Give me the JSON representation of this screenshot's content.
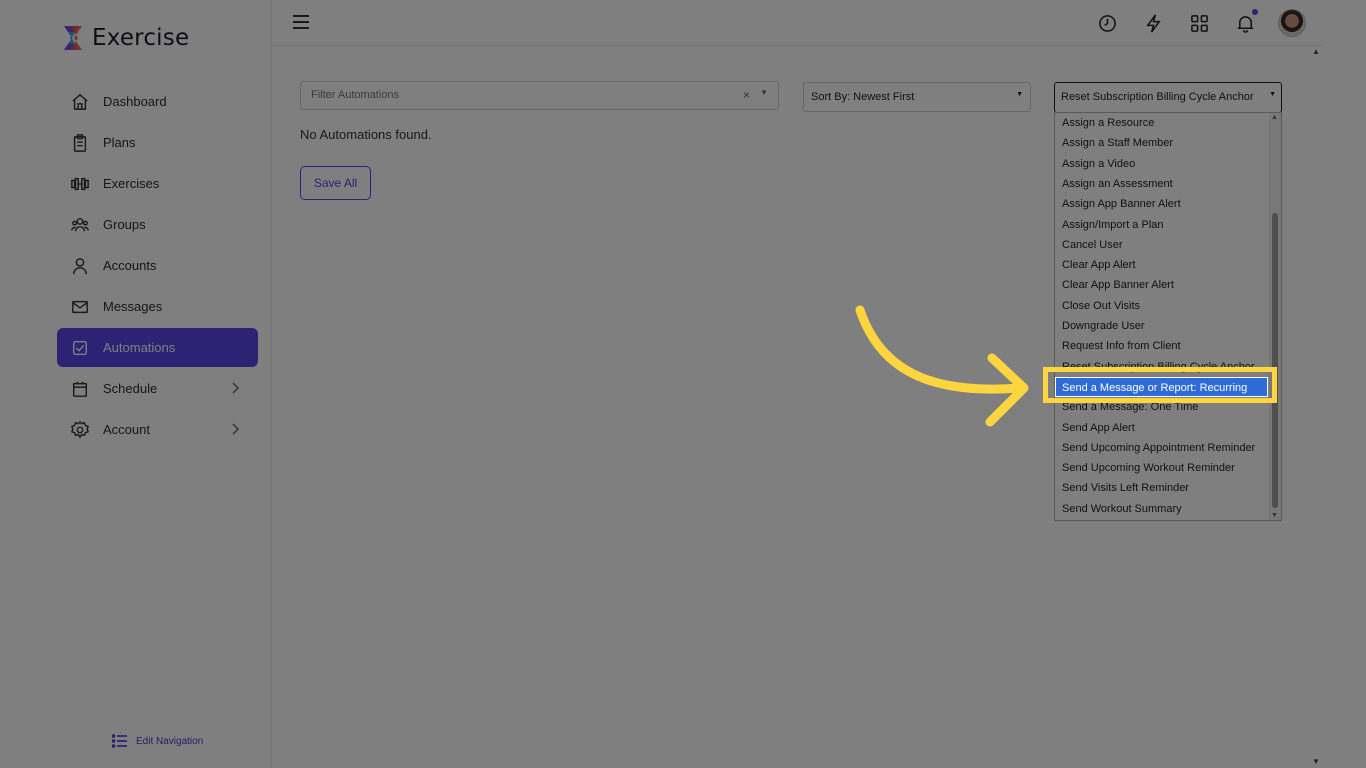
{
  "app": {
    "name": "Exercise"
  },
  "sidebar": {
    "items": [
      {
        "label": "Dashboard",
        "icon": "home-icon",
        "active": false,
        "has_chevron": false
      },
      {
        "label": "Plans",
        "icon": "clipboard-icon",
        "active": false,
        "has_chevron": false
      },
      {
        "label": "Exercises",
        "icon": "dumbbell-icon",
        "active": false,
        "has_chevron": false
      },
      {
        "label": "Groups",
        "icon": "group-icon",
        "active": false,
        "has_chevron": false
      },
      {
        "label": "Accounts",
        "icon": "user-icon",
        "active": false,
        "has_chevron": false
      },
      {
        "label": "Messages",
        "icon": "envelope-icon",
        "active": false,
        "has_chevron": false
      },
      {
        "label": "Automations",
        "icon": "checkbox-icon",
        "active": true,
        "has_chevron": false
      },
      {
        "label": "Schedule",
        "icon": "calendar-icon",
        "active": false,
        "has_chevron": true
      },
      {
        "label": "Account",
        "icon": "gear-icon",
        "active": false,
        "has_chevron": true
      }
    ],
    "edit_nav_label": "Edit Navigation"
  },
  "topbar": {
    "icons": [
      "history-icon",
      "lightning-icon",
      "apps-grid-icon",
      "bell-icon"
    ],
    "has_notification": true
  },
  "main": {
    "filter_placeholder": "Filter Automations",
    "filter_clear": "×",
    "sort_value": "Sort By: Newest First",
    "empty_message": "No Automations found.",
    "save_all_label": "Save All",
    "action_select_value": "Reset Subscription Billing Cycle Anchor",
    "dropdown_options": [
      "Assign a Resource",
      "Assign a Staff Member",
      "Assign a Video",
      "Assign an Assessment",
      "Assign App Banner Alert",
      "Assign/Import a Plan",
      "Cancel User",
      "Clear App Alert",
      "Clear App Banner Alert",
      "Close Out Visits",
      "Downgrade User",
      "Request Info from Client",
      "Reset Subscription Billing Cycle Anchor",
      "Send a Message or Report: Recurring",
      "Send a Message: One Time",
      "Send App Alert",
      "Send Upcoming Appointment Reminder",
      "Send Upcoming Workout Reminder",
      "Send Visits Left Reminder",
      "Send Workout Summary"
    ],
    "highlighted_option": "Send a Message or Report: Recurring"
  },
  "colors": {
    "accent": "#5a45e6",
    "selection": "#2f6bd6",
    "highlight": "#fcd53f",
    "overlay": "rgba(0,0,0,0.5)"
  }
}
